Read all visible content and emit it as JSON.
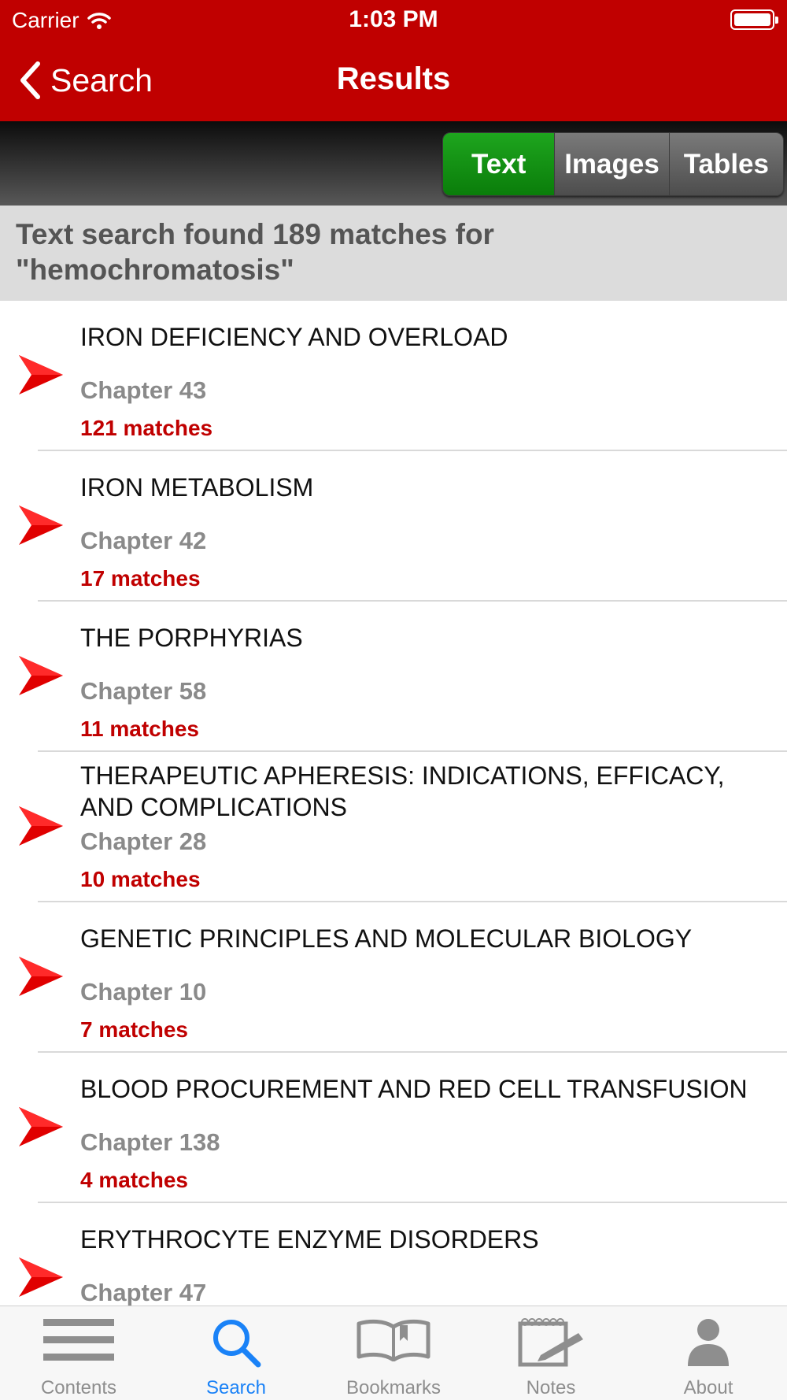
{
  "status_bar": {
    "carrier": "Carrier",
    "time": "1:03 PM"
  },
  "nav": {
    "back_label": "Search",
    "title": "Results"
  },
  "segments": [
    {
      "label": "Text",
      "active": true
    },
    {
      "label": "Images",
      "active": false
    },
    {
      "label": "Tables",
      "active": false
    }
  ],
  "summary": {
    "line1": "Text search found 189 matches for",
    "line2": "\"hemochromatosis\""
  },
  "results": [
    {
      "title": "IRON DEFICIENCY AND OVERLOAD",
      "chapter": "Chapter 43",
      "matches": "121 matches"
    },
    {
      "title": "IRON METABOLISM",
      "chapter": "Chapter 42",
      "matches": "17 matches"
    },
    {
      "title": "THE PORPHYRIAS",
      "chapter": "Chapter 58",
      "matches": "11 matches"
    },
    {
      "title": "THERAPEUTIC APHERESIS: INDICATIONS, EFFICACY, AND COMPLICATIONS",
      "chapter": "Chapter 28",
      "matches": "10 matches"
    },
    {
      "title": "GENETIC PRINCIPLES AND MOLECULAR BIOLOGY",
      "chapter": "Chapter 10",
      "matches": "7 matches"
    },
    {
      "title": "BLOOD PROCUREMENT AND RED CELL TRANSFUSION",
      "chapter": "Chapter 138",
      "matches": "4 matches"
    },
    {
      "title": "ERYTHROCYTE ENZYME DISORDERS",
      "chapter": "Chapter 47",
      "matches": ""
    }
  ],
  "tabs": [
    {
      "label": "Contents",
      "icon": "list-icon"
    },
    {
      "label": "Search",
      "icon": "search-icon",
      "active": true
    },
    {
      "label": "Bookmarks",
      "icon": "book-icon"
    },
    {
      "label": "Notes",
      "icon": "notepad-icon"
    },
    {
      "label": "About",
      "icon": "person-icon"
    }
  ],
  "colors": {
    "brand_red": "#c00000",
    "active_segment": "#1ea51e",
    "active_tab": "#1a82f7"
  }
}
